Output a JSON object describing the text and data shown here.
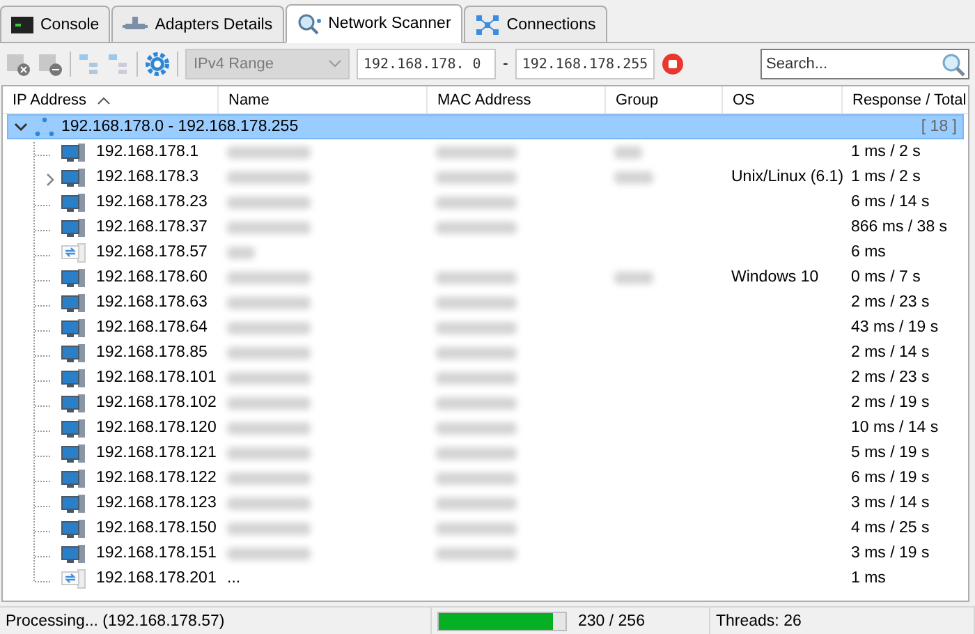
{
  "tabs": [
    {
      "label": "Console",
      "selected": false
    },
    {
      "label": "Adapters Details",
      "selected": false
    },
    {
      "label": "Network Scanner",
      "selected": true
    },
    {
      "label": "Connections",
      "selected": false
    }
  ],
  "toolbar": {
    "range_type": {
      "value": "IPv4 Range",
      "disabled": true
    },
    "range_start": "192.168.178. 0",
    "range_separator": "-",
    "range_end": "192.168.178.255",
    "search": {
      "placeholder": "Search..."
    }
  },
  "table": {
    "columns": [
      {
        "label": "IP Address",
        "sorted_ascending": true
      },
      {
        "label": "Name"
      },
      {
        "label": "MAC Address"
      },
      {
        "label": "Group"
      },
      {
        "label": "OS"
      },
      {
        "label": "Response / Total"
      }
    ],
    "group": {
      "label": "192.168.178.0 - 192.168.178.255",
      "count": "[ 18 ]",
      "expanded": true,
      "selected": true,
      "children": [
        {
          "ip": "192.168.178.1",
          "kind": "host",
          "name_redacted": true,
          "mac_redacted": true,
          "group_redacted": true,
          "response": "1 ms / 2 s"
        },
        {
          "ip": "192.168.178.3",
          "kind": "host",
          "expandable": true,
          "expanded": false,
          "name_redacted": true,
          "mac_redacted": true,
          "group_redacted": true,
          "os": "Unix/Linux (6.1)",
          "response": "1 ms / 2 s"
        },
        {
          "ip": "192.168.178.23",
          "kind": "host",
          "name_redacted": true,
          "mac_redacted": true,
          "response": "6 ms / 14 s"
        },
        {
          "ip": "192.168.178.37",
          "kind": "host",
          "name_redacted": true,
          "mac_redacted": true,
          "response": "866 ms / 38 s"
        },
        {
          "ip": "192.168.178.57",
          "kind": "pending",
          "name_redacted": true,
          "response": "6 ms"
        },
        {
          "ip": "192.168.178.60",
          "kind": "host",
          "name_redacted": true,
          "mac_redacted": true,
          "group_redacted": true,
          "os": "Windows 10",
          "response": "0 ms / 7 s"
        },
        {
          "ip": "192.168.178.63",
          "kind": "host",
          "name_redacted": true,
          "mac_redacted": true,
          "response": "2 ms / 23 s"
        },
        {
          "ip": "192.168.178.64",
          "kind": "host",
          "name_redacted": true,
          "mac_redacted": true,
          "response": "43 ms / 19 s"
        },
        {
          "ip": "192.168.178.85",
          "kind": "host",
          "name_redacted": true,
          "mac_redacted": true,
          "response": "2 ms / 14 s"
        },
        {
          "ip": "192.168.178.101",
          "kind": "host",
          "name_redacted": true,
          "mac_redacted": true,
          "response": "2 ms / 23 s"
        },
        {
          "ip": "192.168.178.102",
          "kind": "host",
          "name_redacted": true,
          "mac_redacted": true,
          "response": "2 ms / 19 s"
        },
        {
          "ip": "192.168.178.120",
          "kind": "host",
          "name_redacted": true,
          "mac_redacted": true,
          "response": "10 ms / 14 s"
        },
        {
          "ip": "192.168.178.121",
          "kind": "host",
          "name_redacted": true,
          "mac_redacted": true,
          "response": "5 ms / 19 s"
        },
        {
          "ip": "192.168.178.122",
          "kind": "host",
          "name_redacted": true,
          "mac_redacted": true,
          "response": "6 ms / 19 s"
        },
        {
          "ip": "192.168.178.123",
          "kind": "host",
          "name_redacted": true,
          "mac_redacted": true,
          "response": "3 ms / 14 s"
        },
        {
          "ip": "192.168.178.150",
          "kind": "host",
          "name_redacted": true,
          "mac_redacted": true,
          "response": "4 ms / 25 s"
        },
        {
          "ip": "192.168.178.151",
          "kind": "host",
          "name_redacted": true,
          "mac_redacted": true,
          "response": "3 ms / 19 s"
        },
        {
          "ip": "192.168.178.201",
          "kind": "pending",
          "name": "...",
          "response": "1 ms"
        }
      ]
    }
  },
  "status_bar": {
    "message": "Processing... (192.168.178.57)",
    "progress": {
      "level": 0.9
    },
    "count": "230 / 256",
    "threads": "Threads: 26"
  }
}
